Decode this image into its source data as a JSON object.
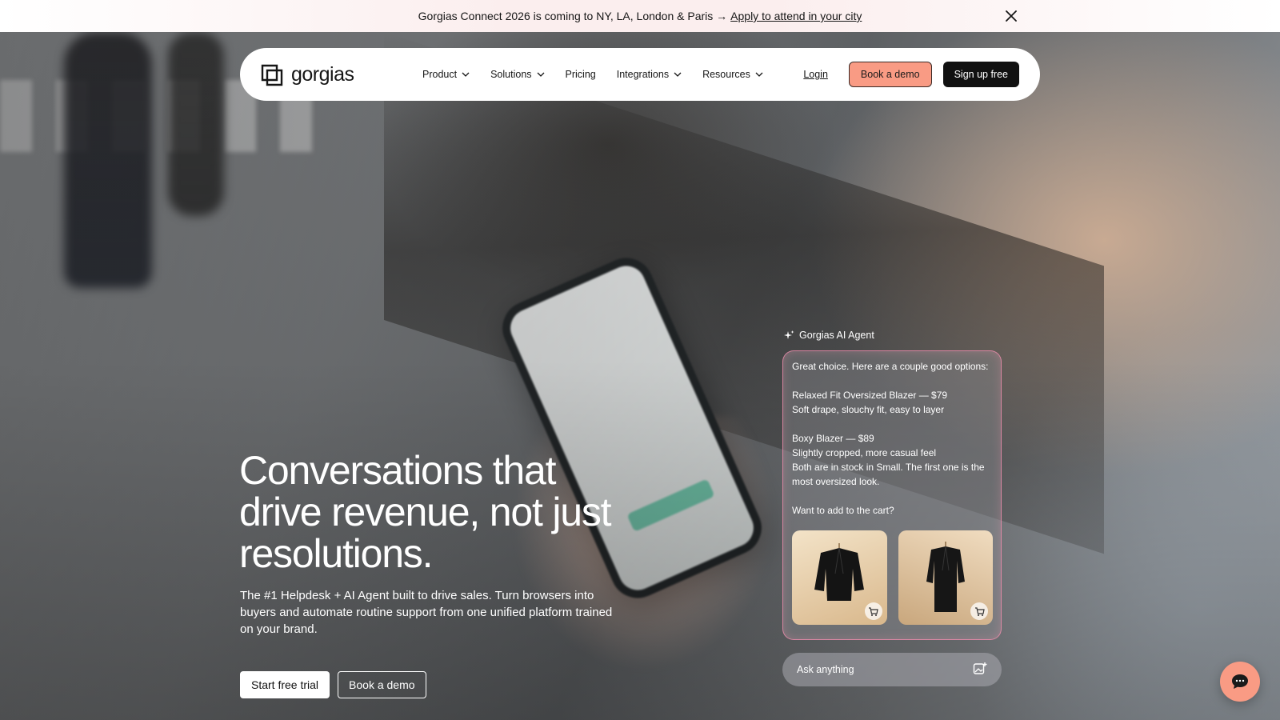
{
  "announcement": {
    "text": "Gorgias Connect 2026 is coming to NY, LA, London & Paris →",
    "link": "Apply to attend in your city"
  },
  "nav": {
    "logo_text": "gorgias",
    "menu": [
      {
        "label": "Product",
        "has_dropdown": true
      },
      {
        "label": "Solutions",
        "has_dropdown": true
      },
      {
        "label": "Pricing",
        "has_dropdown": false
      },
      {
        "label": "Integrations",
        "has_dropdown": true
      },
      {
        "label": "Resources",
        "has_dropdown": true
      }
    ],
    "login": "Login",
    "book_demo": "Book a demo",
    "sign_up": "Sign up free"
  },
  "hero": {
    "title_line1": "Conversations that",
    "title_line2": "drive revenue, not just",
    "title_line3": "resolutions.",
    "subtitle": "The #1 Helpdesk + AI Agent built to drive sales. Turn browsers into buyers and automate routine support from one unified platform trained on your brand.",
    "cta_primary": "Start free trial",
    "cta_secondary": "Book a demo"
  },
  "agent": {
    "label": "Gorgias AI Agent",
    "intro": "Great choice. Here are a couple good options:",
    "option1_title": "Relaxed Fit Oversized Blazer — $79",
    "option1_desc": "Soft drape, slouchy fit, easy to layer",
    "option2_title": "Boxy Blazer — $89",
    "option2_desc": "Slightly cropped, more casual feel",
    "stock_note": "Both are in stock in Small. The first one is the most oversized look.",
    "question": "Want to add to the cart?",
    "ask_placeholder": "Ask anything"
  },
  "colors": {
    "accent": "#f99b84",
    "dark": "#111111",
    "agent_border": "#eb8caa"
  },
  "icons": {
    "close": "close-icon",
    "chevron": "chevron-down-icon",
    "sparkle": "sparkle-icon",
    "cart": "add-to-cart-icon",
    "image_upload": "image-upload-icon",
    "chat": "chat-bubble-icon"
  }
}
